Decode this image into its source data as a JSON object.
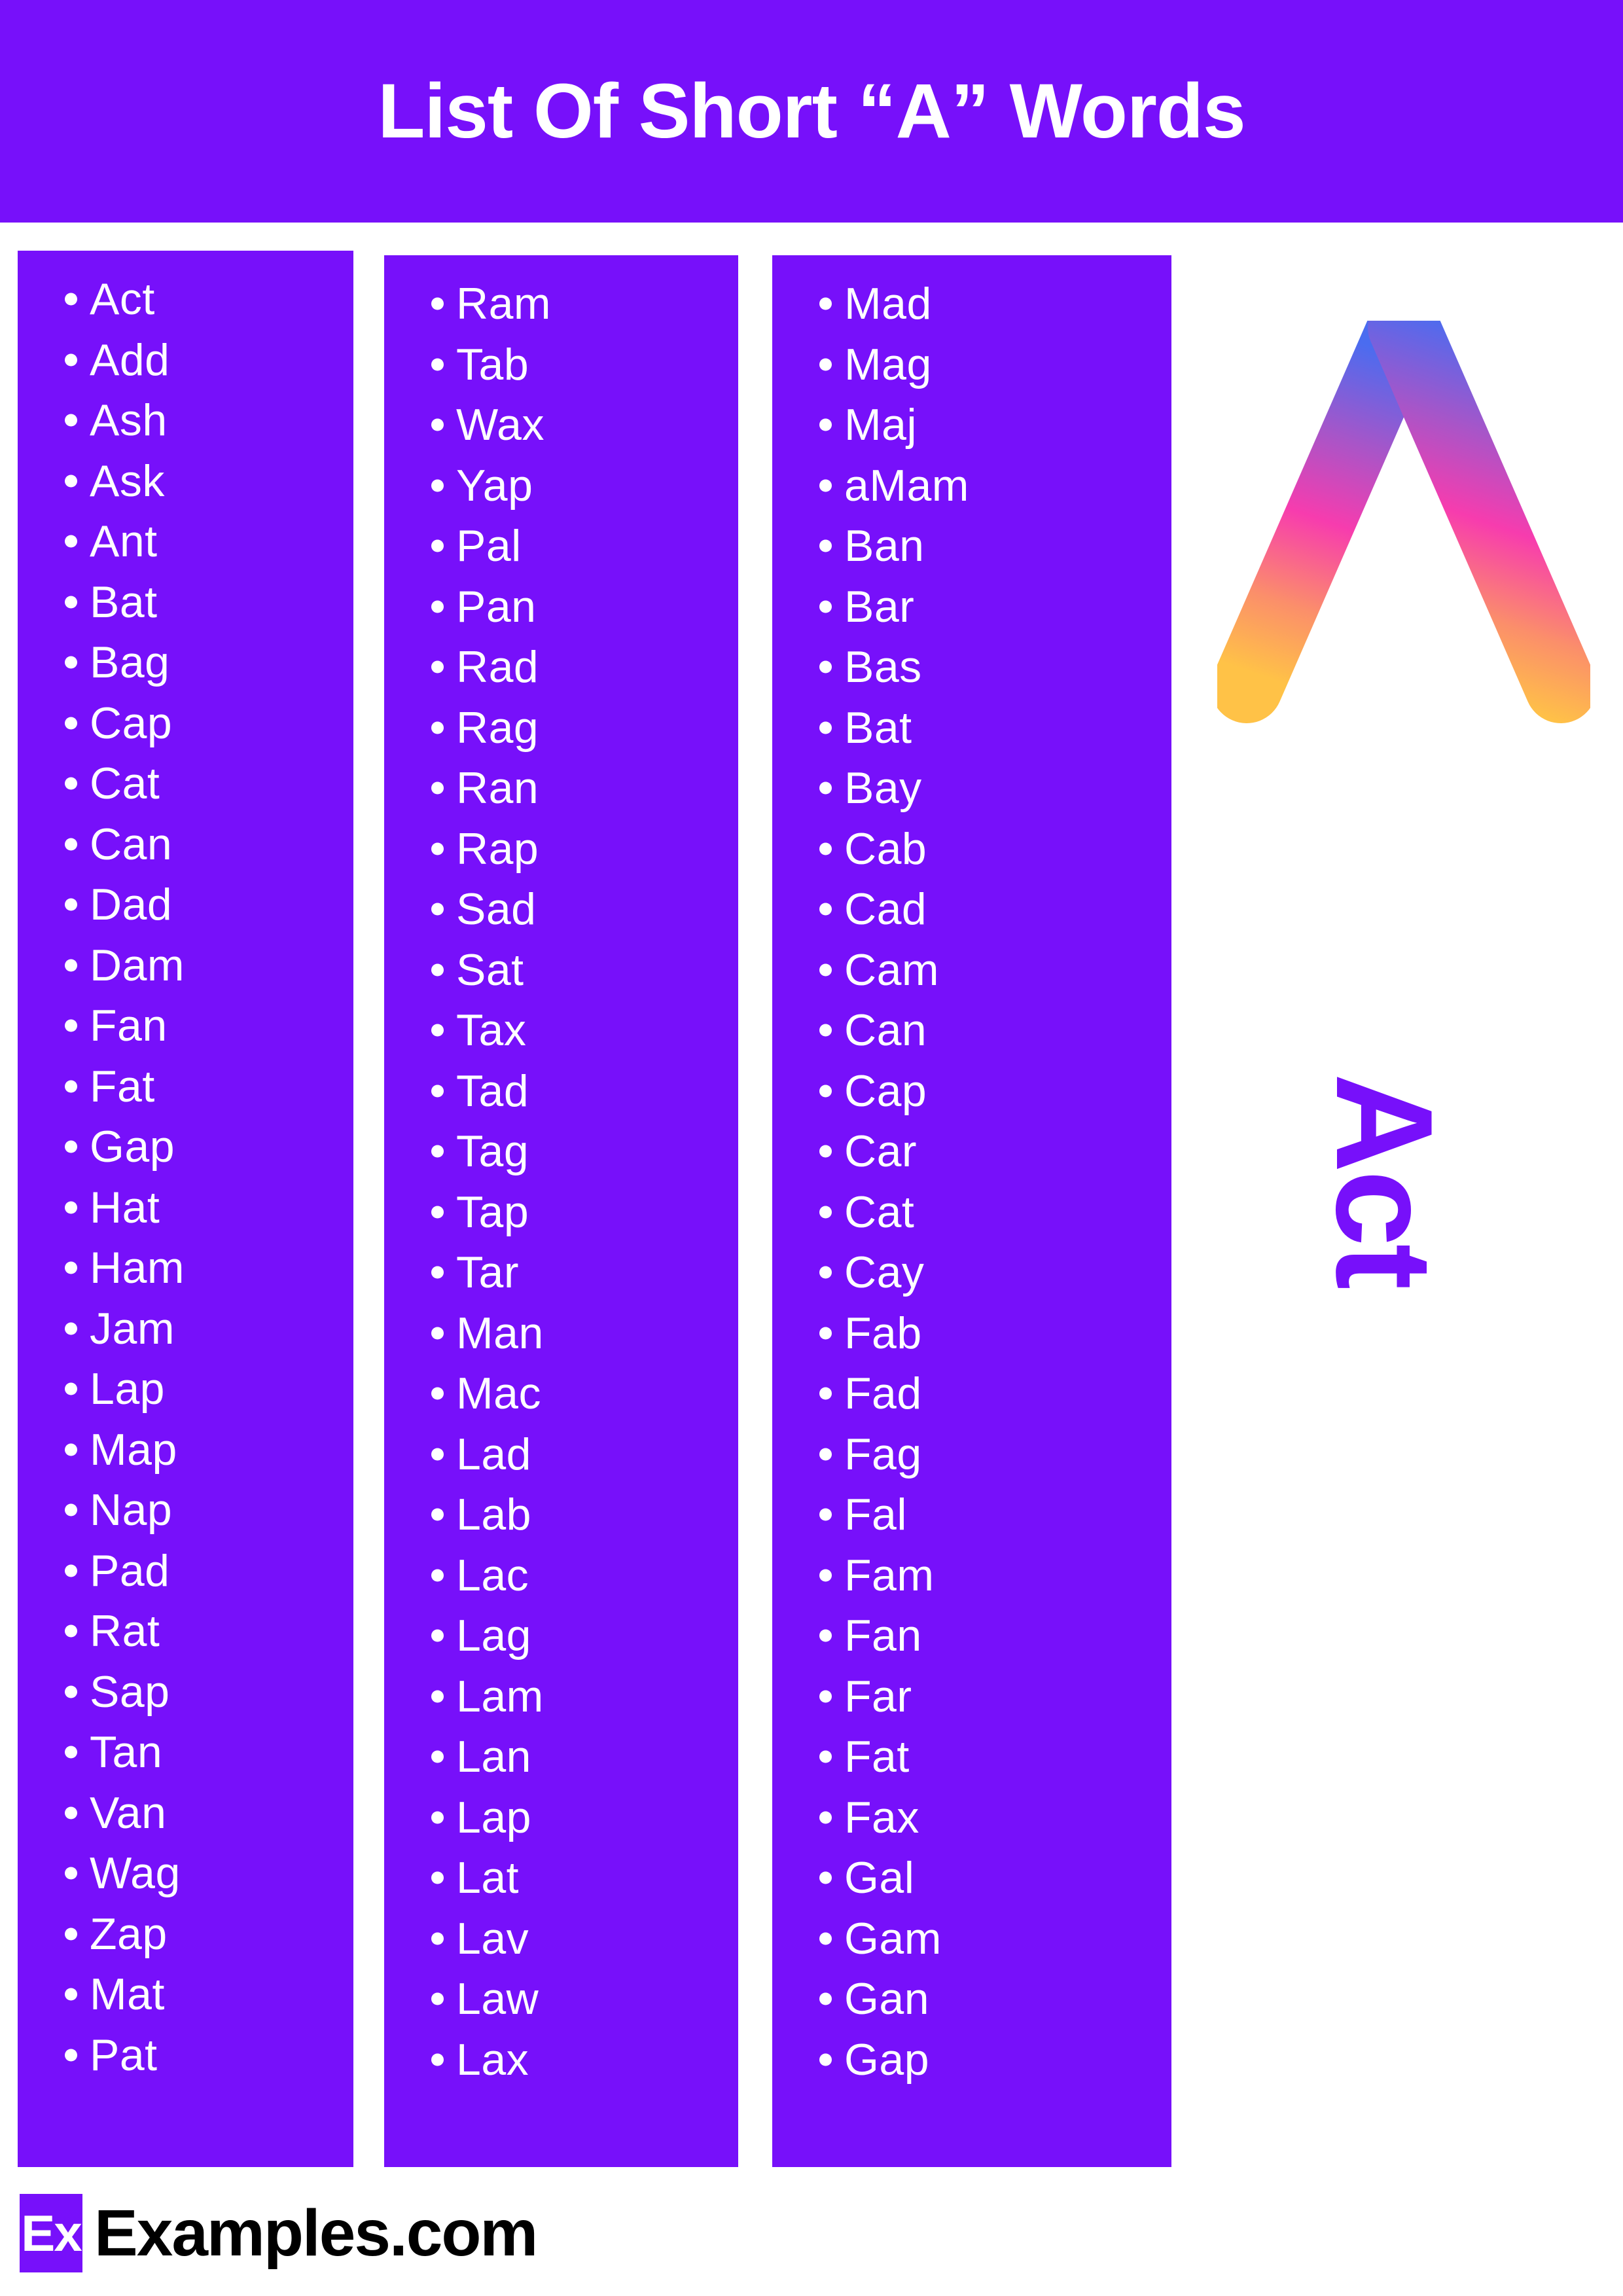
{
  "header": {
    "title": "List Of Short “A” Words",
    "background_color": "#7710fa",
    "text_color": "#ffffff"
  },
  "theme": {
    "purple": "#7710fa",
    "white": "#ffffff",
    "black": "#000000"
  },
  "columns": [
    {
      "id": "column-1",
      "words": [
        "Act",
        "Add",
        "Ash",
        "Ask",
        "Ant",
        "Bat",
        "Bag",
        "Cap",
        "Cat",
        "Can",
        "Dad",
        "Dam",
        "Fan",
        "Fat",
        "Gap",
        "Hat",
        "Ham",
        "Jam",
        "Lap",
        "Map",
        "Nap",
        "Pad",
        "Rat",
        "Sap",
        "Tan",
        "Van",
        "Wag",
        "Zap",
        "Mat",
        "Pat"
      ]
    },
    {
      "id": "column-2",
      "words": [
        "Ram",
        "Tab",
        "Wax",
        "Yap",
        "Pal",
        "Pan",
        "Rad",
        "Rag",
        "Ran",
        "Rap",
        "Sad",
        "Sat",
        "Tax",
        "Tad",
        "Tag",
        "Tap",
        "Tar",
        "Man",
        "Mac",
        "Lad",
        "Lab",
        "Lac",
        "Lag",
        "Lam",
        "Lan",
        "Lap",
        "Lat",
        "Lav",
        "Law",
        "Lax"
      ]
    },
    {
      "id": "column-3",
      "words": [
        "Mad",
        "Mag",
        "Maj",
        "aMam",
        "Ban",
        "Bar",
        "Bas",
        "Bat",
        "Bay",
        "Cab",
        "Cad",
        "Cam",
        "Can",
        "Cap",
        "Car",
        "Cat",
        "Cay",
        "Fab",
        "Fad",
        "Fag",
        "Fal",
        "Fam",
        "Fan",
        "Far",
        "Fat",
        "Fax",
        "Gal",
        "Gam",
        "Gan",
        "Gap"
      ]
    }
  ],
  "graphic": {
    "letter": "A",
    "gradient_stops": [
      "#4a6cf0",
      "#a855c8",
      "#f73cae",
      "#fb8f6a",
      "#ffc247"
    ],
    "vertical_word": "Act",
    "vertical_word_color": "#7710fa"
  },
  "footer": {
    "badge_label": "Ex",
    "brand": "Examples.com",
    "badge_background": "#7710fa",
    "brand_color": "#000000"
  }
}
